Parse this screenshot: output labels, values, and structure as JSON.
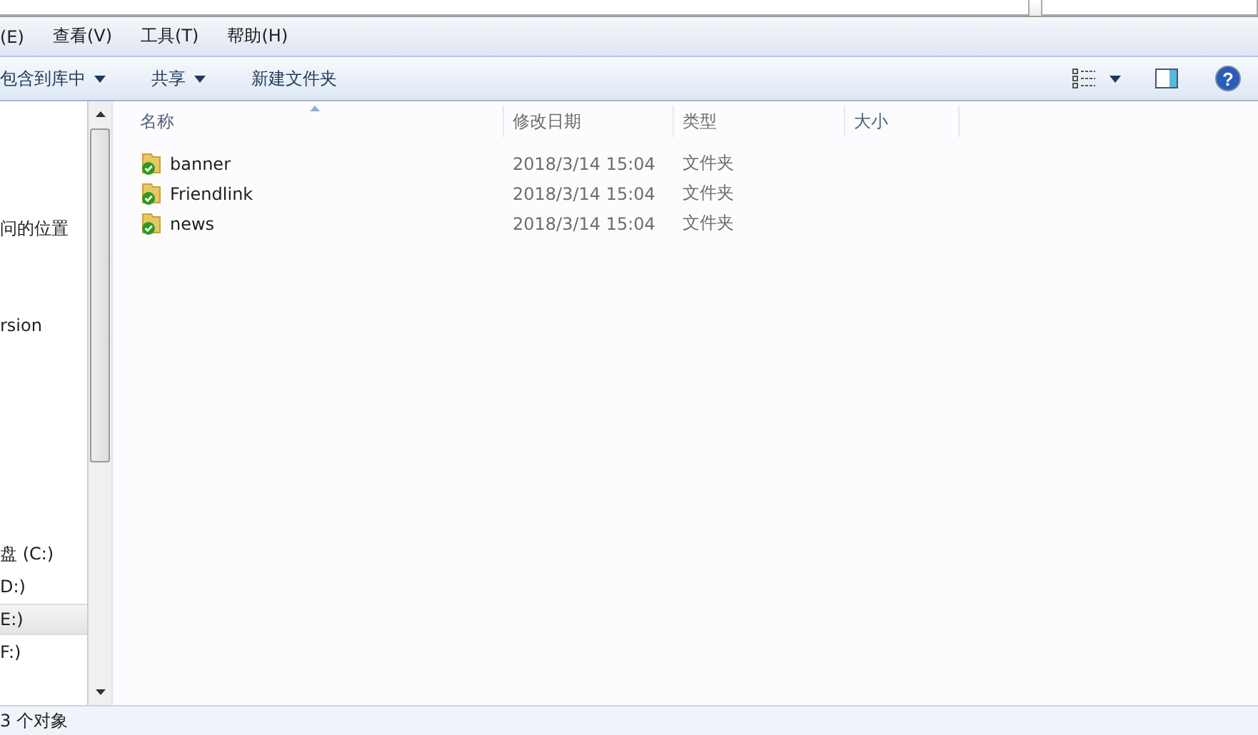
{
  "menu": [
    "(E)",
    "查看(V)",
    "工具(T)",
    "帮助(H)"
  ],
  "toolbar": {
    "buttons": [
      {
        "label": "包含到库中",
        "dropdown": true
      },
      {
        "label": "共享",
        "dropdown": true
      },
      {
        "label": "新建文件夹",
        "dropdown": false
      }
    ]
  },
  "help_button": "?",
  "sidebar": {
    "items": [
      {
        "label": "问的位置",
        "selected": false
      },
      {
        "label": "rsion",
        "selected": false
      },
      {
        "label": "盘 (C:)",
        "selected": false
      },
      {
        "label": "D:)",
        "selected": false
      },
      {
        "label": "E:)",
        "selected": true
      },
      {
        "label": "F:)",
        "selected": false
      }
    ]
  },
  "table": {
    "columns": [
      "名称",
      "修改日期",
      "类型",
      "大小"
    ],
    "rows": [
      {
        "name": "banner",
        "modified": "2018/3/14 15:04",
        "type": "文件夹"
      },
      {
        "name": "Friendlink",
        "modified": "2018/3/14 15:04",
        "type": "文件夹"
      },
      {
        "name": "news",
        "modified": "2018/3/14 15:04",
        "type": "文件夹"
      }
    ]
  },
  "status_bar": "3 个对象"
}
